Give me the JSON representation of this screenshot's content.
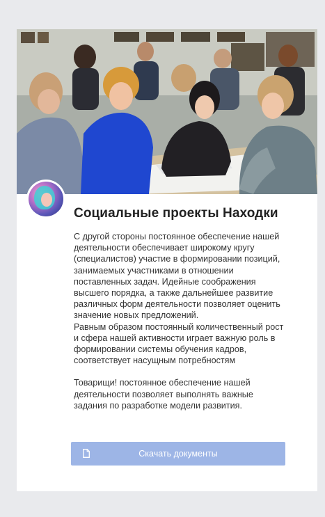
{
  "card": {
    "photo_alt": "Участники за столом",
    "avatar_icon": "community-avatar-icon",
    "title": "Социальные проекты Находки",
    "paragraphs": [
      "С другой стороны постоянное обеспечение нашей деятельности обеспечивает широкому кругу (специалистов) участие в формировании позиций, занимаемых участниками в отношении поставленных задач. Идейные соображения высшего порядка, а также дальнейшее развитие различных форм деятельности позволяет оценить значение новых предложений.",
      "Равным образом постоянный количественный рост и сфера нашей активности играет важную роль в формировании системы обучения кадров, соответствует насущным потребностям",
      "Товарищи! постоянное обеспечение нашей деятельности позволяет выполнять важные задания по разработке модели развития."
    ],
    "download": {
      "icon": "document-icon",
      "label": "Скачать документы",
      "color": "#9db5e6"
    }
  },
  "colors": {
    "page_bg": "#e9eaed",
    "card_bg": "#ffffff",
    "title": "#222222",
    "text": "#333333"
  }
}
